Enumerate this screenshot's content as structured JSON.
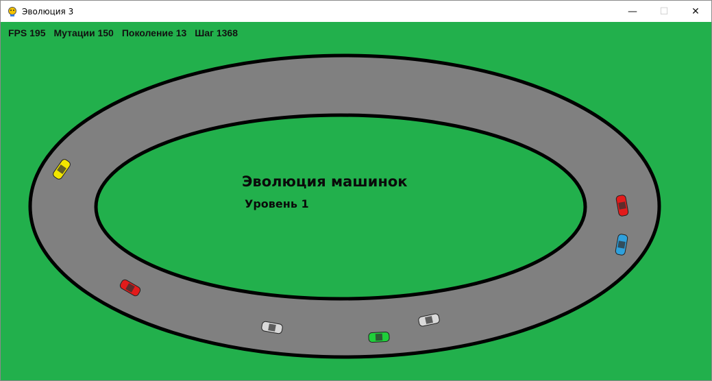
{
  "window": {
    "title": "Эволюция 3",
    "controls": {
      "minimize": "—",
      "maximize": "☐",
      "close": "✕"
    }
  },
  "hud": {
    "fps": "FPS 195",
    "mutations": "Мутации 150",
    "generation": "Поколение 13",
    "step": "Шаг 1368"
  },
  "game": {
    "title": "Эволюция машинок",
    "level": "Уровень 1"
  },
  "cars": [
    {
      "color": "#f2e600"
    },
    {
      "color": "#e31b1b"
    },
    {
      "color": "#e31b1b"
    },
    {
      "color": "#2fa0dc"
    },
    {
      "color": "#d9d9d9"
    },
    {
      "color": "#1fcf3a"
    },
    {
      "color": "#d9d9d9"
    }
  ],
  "colors": {
    "grass": "#22b04c",
    "track": "#808080",
    "border": "#000000"
  }
}
